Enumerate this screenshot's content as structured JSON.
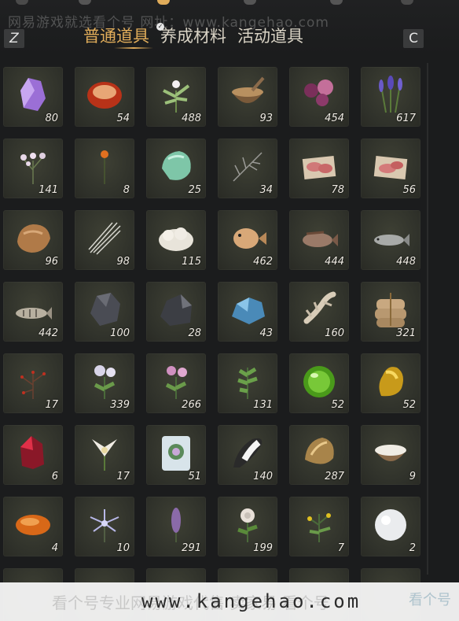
{
  "watermark_top": "网易游戏就选看个号   网址：www.kangehao.com",
  "keys": {
    "left": "Z",
    "right": "C"
  },
  "tabs": [
    {
      "label": "普通道具",
      "active": true
    },
    {
      "label": "养成材料",
      "active": false
    },
    {
      "label": "活动道具",
      "active": false
    }
  ],
  "tab_badge": "✓",
  "colors": {
    "accent": "#e0ac5a",
    "slot": "#33352d"
  },
  "items": [
    {
      "name": "amethyst-crystal-icon",
      "qty": "80"
    },
    {
      "name": "red-agate-stone-icon",
      "qty": "54"
    },
    {
      "name": "white-herb-icon",
      "qty": "488"
    },
    {
      "name": "mortar-bowl-icon",
      "qty": "93"
    },
    {
      "name": "purple-flowers-icon",
      "qty": "454"
    },
    {
      "name": "lavender-plant-icon",
      "qty": "617"
    },
    {
      "name": "baby-breath-flower-icon",
      "qty": "141"
    },
    {
      "name": "orange-wildflower-icon",
      "qty": "8"
    },
    {
      "name": "jade-stone-icon",
      "qty": "25"
    },
    {
      "name": "dried-twig-icon",
      "qty": "34"
    },
    {
      "name": "raw-meat-icon",
      "qty": "78"
    },
    {
      "name": "sliced-meat-icon",
      "qty": "56"
    },
    {
      "name": "fur-pelt-icon",
      "qty": "96"
    },
    {
      "name": "white-quills-icon",
      "qty": "98"
    },
    {
      "name": "white-wool-icon",
      "qty": "115"
    },
    {
      "name": "pufferfish-icon",
      "qty": "462"
    },
    {
      "name": "rockfish-icon",
      "qty": "444"
    },
    {
      "name": "silver-fish-icon",
      "qty": "448"
    },
    {
      "name": "striped-fish-icon",
      "qty": "442"
    },
    {
      "name": "coal-ore-icon",
      "qty": "100"
    },
    {
      "name": "iron-ore-icon",
      "qty": "28"
    },
    {
      "name": "blue-crystal-ore-icon",
      "qty": "43"
    },
    {
      "name": "animal-bone-icon",
      "qty": "160"
    },
    {
      "name": "grain-sacks-icon",
      "qty": "321"
    },
    {
      "name": "red-berry-branch-icon",
      "qty": "17"
    },
    {
      "name": "white-aster-flower-icon",
      "qty": "339"
    },
    {
      "name": "pink-aster-flower-icon",
      "qty": "266"
    },
    {
      "name": "green-herb-sprig-icon",
      "qty": "131"
    },
    {
      "name": "green-jade-orb-icon",
      "qty": "52"
    },
    {
      "name": "gold-nugget-icon",
      "qty": "52"
    },
    {
      "name": "red-ruby-ore-icon",
      "qty": "6"
    },
    {
      "name": "white-lily-icon",
      "qty": "17"
    },
    {
      "name": "preserved-flower-block-icon",
      "qty": "51"
    },
    {
      "name": "fox-tail-icon",
      "qty": "140"
    },
    {
      "name": "golden-shell-icon",
      "qty": "287"
    },
    {
      "name": "milk-bowl-icon",
      "qty": "9"
    },
    {
      "name": "amber-stone-icon",
      "qty": "4"
    },
    {
      "name": "lilac-spider-flower-icon",
      "qty": "10"
    },
    {
      "name": "purple-spike-flower-icon",
      "qty": "291"
    },
    {
      "name": "white-rose-icon",
      "qty": "199"
    },
    {
      "name": "yellow-wildflower-icon",
      "qty": "7"
    },
    {
      "name": "white-pearl-ball-icon",
      "qty": "2"
    }
  ],
  "banner": {
    "background_text": "看个号专业网易游戏代售   卖家易 看个号",
    "url": "www.kangehao.com",
    "logo_text": "看个号"
  }
}
